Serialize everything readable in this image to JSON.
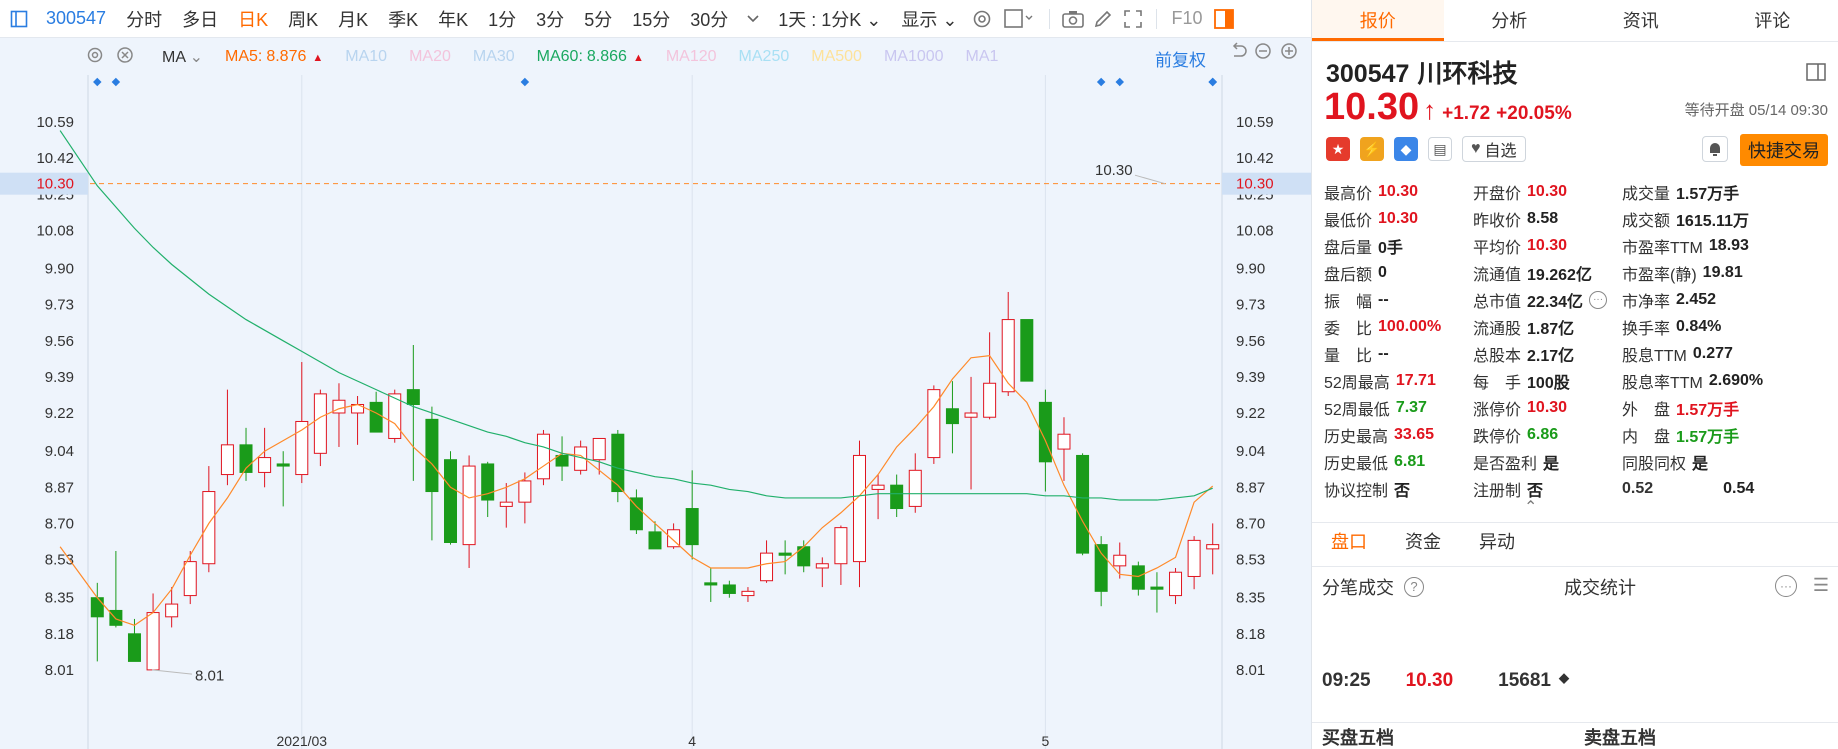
{
  "toolbar": {
    "code": "300547",
    "timeframes": [
      "分时",
      "多日",
      "日K",
      "周K",
      "月K",
      "季K",
      "年K",
      "1分",
      "3分",
      "5分",
      "15分",
      "30分"
    ],
    "active_timeframe": "日K",
    "range": "1天 : 1分K",
    "display": "显示",
    "f10": "F10"
  },
  "ma_bar": {
    "label": "MA",
    "items": [
      {
        "name": "MA5:",
        "value": "8.876",
        "color": "#ff6a00",
        "arrow": "▲"
      },
      {
        "name": "MA10",
        "value": "",
        "color": "#b8d4ef",
        "arrow": ""
      },
      {
        "name": "MA20",
        "value": "",
        "color": "#f3c4dc",
        "arrow": ""
      },
      {
        "name": "MA30",
        "value": "",
        "color": "#b8d4ef",
        "arrow": ""
      },
      {
        "name": "MA60:",
        "value": "8.866",
        "color": "#1aa860",
        "arrow": "▲"
      },
      {
        "name": "MA120",
        "value": "",
        "color": "#f3c4dc",
        "arrow": ""
      },
      {
        "name": "MA250",
        "value": "",
        "color": "#a9e0f4",
        "arrow": ""
      },
      {
        "name": "MA500",
        "value": "",
        "color": "#fde29a",
        "arrow": ""
      },
      {
        "name": "MA1000",
        "value": "",
        "color": "#c9c6f0",
        "arrow": ""
      },
      {
        "name": "MA1",
        "value": "",
        "color": "#c9c6f0",
        "arrow": ""
      }
    ],
    "fuquan": "前复权"
  },
  "chart_data": {
    "type": "candlestick",
    "y_ticks": [
      "10.59",
      "10.42",
      "10.25",
      "10.08",
      "9.90",
      "9.73",
      "9.56",
      "9.39",
      "9.22",
      "9.04",
      "8.87",
      "8.70",
      "8.53",
      "8.35",
      "8.18",
      "8.01"
    ],
    "ylim": [
      7.92,
      10.68
    ],
    "x_labels": [
      {
        "label": "2021/03",
        "index": 11
      },
      {
        "label": "4",
        "index": 32
      },
      {
        "label": "5",
        "index": 51
      }
    ],
    "current_price_label": "10.30",
    "right_annotation": "10.30",
    "low_annotation": "8.01",
    "candles": [
      {
        "o": 8.35,
        "h": 8.42,
        "l": 8.05,
        "c": 8.26
      },
      {
        "o": 8.29,
        "h": 8.57,
        "l": 8.21,
        "c": 8.22
      },
      {
        "o": 8.18,
        "h": 8.25,
        "l": 8.05,
        "c": 8.05
      },
      {
        "o": 8.01,
        "h": 8.37,
        "l": 8.01,
        "c": 8.28
      },
      {
        "o": 8.26,
        "h": 8.4,
        "l": 8.21,
        "c": 8.32
      },
      {
        "o": 8.36,
        "h": 8.57,
        "l": 8.32,
        "c": 8.52
      },
      {
        "o": 8.51,
        "h": 8.97,
        "l": 8.47,
        "c": 8.85
      },
      {
        "o": 8.93,
        "h": 9.33,
        "l": 8.88,
        "c": 9.07
      },
      {
        "o": 9.07,
        "h": 9.15,
        "l": 8.9,
        "c": 8.94
      },
      {
        "o": 8.94,
        "h": 9.15,
        "l": 8.87,
        "c": 9.01
      },
      {
        "o": 8.98,
        "h": 9.04,
        "l": 8.78,
        "c": 8.97
      },
      {
        "o": 8.93,
        "h": 9.46,
        "l": 8.89,
        "c": 9.18
      },
      {
        "o": 9.03,
        "h": 9.33,
        "l": 8.97,
        "c": 9.31
      },
      {
        "o": 9.22,
        "h": 9.36,
        "l": 9.06,
        "c": 9.28
      },
      {
        "o": 9.22,
        "h": 9.3,
        "l": 9.07,
        "c": 9.26
      },
      {
        "o": 9.27,
        "h": 9.32,
        "l": 9.15,
        "c": 9.13
      },
      {
        "o": 9.1,
        "h": 9.33,
        "l": 9.08,
        "c": 9.31
      },
      {
        "o": 9.33,
        "h": 9.54,
        "l": 8.9,
        "c": 9.26
      },
      {
        "o": 9.19,
        "h": 9.25,
        "l": 8.62,
        "c": 8.85
      },
      {
        "o": 9.0,
        "h": 9.04,
        "l": 8.6,
        "c": 8.61
      },
      {
        "o": 8.6,
        "h": 9.02,
        "l": 8.49,
        "c": 8.97
      },
      {
        "o": 8.98,
        "h": 8.99,
        "l": 8.73,
        "c": 8.81
      },
      {
        "o": 8.78,
        "h": 8.89,
        "l": 8.68,
        "c": 8.8
      },
      {
        "o": 8.8,
        "h": 8.94,
        "l": 8.7,
        "c": 8.9
      },
      {
        "o": 8.91,
        "h": 9.14,
        "l": 8.88,
        "c": 9.12
      },
      {
        "o": 9.02,
        "h": 9.11,
        "l": 8.9,
        "c": 8.97
      },
      {
        "o": 8.95,
        "h": 9.09,
        "l": 8.93,
        "c": 9.06
      },
      {
        "o": 9.0,
        "h": 9.09,
        "l": 8.93,
        "c": 9.1
      },
      {
        "o": 9.12,
        "h": 9.14,
        "l": 8.8,
        "c": 8.85
      },
      {
        "o": 8.82,
        "h": 8.86,
        "l": 8.65,
        "c": 8.67
      },
      {
        "o": 8.66,
        "h": 8.71,
        "l": 8.58,
        "c": 8.58
      },
      {
        "o": 8.59,
        "h": 8.7,
        "l": 8.58,
        "c": 8.67
      },
      {
        "o": 8.77,
        "h": 8.95,
        "l": 8.53,
        "c": 8.6
      },
      {
        "o": 8.42,
        "h": 8.49,
        "l": 8.33,
        "c": 8.41
      },
      {
        "o": 8.41,
        "h": 8.43,
        "l": 8.35,
        "c": 8.37
      },
      {
        "o": 8.36,
        "h": 8.4,
        "l": 8.33,
        "c": 8.38
      },
      {
        "o": 8.43,
        "h": 8.62,
        "l": 8.42,
        "c": 8.56
      },
      {
        "o": 8.56,
        "h": 8.62,
        "l": 8.46,
        "c": 8.55
      },
      {
        "o": 8.59,
        "h": 8.62,
        "l": 8.47,
        "c": 8.5
      },
      {
        "o": 8.49,
        "h": 8.54,
        "l": 8.4,
        "c": 8.51
      },
      {
        "o": 8.51,
        "h": 8.69,
        "l": 8.41,
        "c": 8.68
      },
      {
        "o": 8.52,
        "h": 9.09,
        "l": 8.4,
        "c": 9.02
      },
      {
        "o": 8.86,
        "h": 8.93,
        "l": 8.72,
        "c": 8.88
      },
      {
        "o": 8.88,
        "h": 8.93,
        "l": 8.73,
        "c": 8.77
      },
      {
        "o": 8.78,
        "h": 9.03,
        "l": 8.75,
        "c": 8.95
      },
      {
        "o": 9.01,
        "h": 9.35,
        "l": 8.98,
        "c": 9.33
      },
      {
        "o": 9.24,
        "h": 9.37,
        "l": 9.03,
        "c": 9.17
      },
      {
        "o": 9.2,
        "h": 9.39,
        "l": 8.86,
        "c": 9.22
      },
      {
        "o": 9.2,
        "h": 9.6,
        "l": 9.19,
        "c": 9.36
      },
      {
        "o": 9.32,
        "h": 9.79,
        "l": 9.3,
        "c": 9.66
      },
      {
        "o": 9.66,
        "h": 9.66,
        "l": 9.37,
        "c": 9.37
      },
      {
        "o": 9.27,
        "h": 9.33,
        "l": 8.85,
        "c": 8.99
      },
      {
        "o": 9.05,
        "h": 9.2,
        "l": 8.9,
        "c": 9.12
      },
      {
        "o": 9.02,
        "h": 9.03,
        "l": 8.55,
        "c": 8.56
      },
      {
        "o": 8.6,
        "h": 8.64,
        "l": 8.31,
        "c": 8.38
      },
      {
        "o": 8.5,
        "h": 8.61,
        "l": 8.44,
        "c": 8.55
      },
      {
        "o": 8.5,
        "h": 8.52,
        "l": 8.36,
        "c": 8.39
      },
      {
        "o": 8.4,
        "h": 8.47,
        "l": 8.28,
        "c": 8.39
      },
      {
        "o": 8.36,
        "h": 8.49,
        "l": 8.32,
        "c": 8.47
      },
      {
        "o": 8.45,
        "h": 8.64,
        "l": 8.39,
        "c": 8.62
      },
      {
        "o": 8.58,
        "h": 8.7,
        "l": 8.46,
        "c": 8.6
      }
    ],
    "series": [
      {
        "name": "MA5",
        "color": "#ff8a2a",
        "values": [
          8.59,
          8.47,
          8.35,
          8.25,
          8.22,
          8.28,
          8.39,
          8.55,
          8.7,
          8.82,
          8.96,
          9.04,
          9.09,
          9.14,
          9.2,
          9.24,
          9.26,
          9.22,
          9.17,
          9.06,
          8.98,
          8.87,
          8.82,
          8.84,
          8.87,
          8.91,
          8.97,
          9.03,
          9.02,
          8.95,
          8.88,
          8.78,
          8.7,
          8.62,
          8.54,
          8.49,
          8.49,
          8.49,
          8.51,
          8.52,
          8.59,
          8.68,
          8.75,
          8.83,
          8.93,
          9.06,
          9.15,
          9.25,
          9.38,
          9.48,
          9.49,
          9.36,
          9.27,
          9.09,
          8.88,
          8.71,
          8.56,
          8.46,
          8.45,
          8.49,
          8.54,
          8.8,
          8.876
        ]
      },
      {
        "name": "MA60",
        "color": "#21b06b",
        "values": [
          10.55,
          10.42,
          10.29,
          10.19,
          10.09,
          10.0,
          9.92,
          9.85,
          9.78,
          9.72,
          9.66,
          9.61,
          9.56,
          9.51,
          9.46,
          9.41,
          9.37,
          9.33,
          9.29,
          9.25,
          9.22,
          9.19,
          9.16,
          9.13,
          9.11,
          9.08,
          9.06,
          9.03,
          9.01,
          8.99,
          8.96,
          8.94,
          8.92,
          8.91,
          8.89,
          8.88,
          8.86,
          8.85,
          8.83,
          8.82,
          8.82,
          8.82,
          8.82,
          8.83,
          8.84,
          8.84,
          8.84,
          8.84,
          8.84,
          8.84,
          8.84,
          8.84,
          8.84,
          8.83,
          8.83,
          8.82,
          8.82,
          8.81,
          8.81,
          8.81,
          8.82,
          8.83,
          8.866
        ]
      }
    ]
  },
  "stock": {
    "code": "300547",
    "name": "川环科技",
    "price": "10.30",
    "arrow": "↑",
    "change": "+1.72",
    "pct": "+20.05%",
    "status": "等待开盘 05/14 09:30",
    "watch": "自选",
    "quick_trade": "快捷交易"
  },
  "quote_grid": [
    [
      {
        "l": "最高价",
        "v": "10.30",
        "c": "red"
      },
      {
        "l": "开盘价",
        "v": "10.30",
        "c": "red"
      },
      {
        "l": "成交量",
        "v": "1.57万手",
        "c": "blk"
      }
    ],
    [
      {
        "l": "最低价",
        "v": "10.30",
        "c": "red"
      },
      {
        "l": "昨收价",
        "v": "8.58",
        "c": "blk"
      },
      {
        "l": "成交额",
        "v": "1615.11万",
        "c": "blk"
      }
    ],
    [
      {
        "l": "盘后量",
        "v": "0手",
        "c": "blk"
      },
      {
        "l": "平均价",
        "v": "10.30",
        "c": "red"
      },
      {
        "l": "市盈率TTM",
        "v": "18.93",
        "c": "blk"
      }
    ],
    [
      {
        "l": "盘后额",
        "v": "0",
        "c": "blk"
      },
      {
        "l": "流通值",
        "v": "19.262亿",
        "c": "blk"
      },
      {
        "l": "市盈率(静)",
        "v": "19.81",
        "c": "blk"
      }
    ],
    [
      {
        "l": "振　幅",
        "v": "--",
        "c": "blk"
      },
      {
        "l": "总市值",
        "v": "22.34亿",
        "c": "blk"
      },
      {
        "l": "市净率",
        "v": "2.452",
        "c": "blk"
      }
    ],
    [
      {
        "l": "委　比",
        "v": "100.00%",
        "c": "red"
      },
      {
        "l": "流通股",
        "v": "1.87亿",
        "c": "blk"
      },
      {
        "l": "换手率",
        "v": "0.84%",
        "c": "blk"
      }
    ],
    [
      {
        "l": "量　比",
        "v": "--",
        "c": "blk"
      },
      {
        "l": "总股本",
        "v": "2.17亿",
        "c": "blk"
      },
      {
        "l": "股息TTM",
        "v": "0.277",
        "c": "blk"
      }
    ],
    [
      {
        "l": "52周最高",
        "v": "17.71",
        "c": "red"
      },
      {
        "l": "每　手",
        "v": "100股",
        "c": "blk"
      },
      {
        "l": "股息率TTM",
        "v": "2.690%",
        "c": "blk"
      }
    ],
    [
      {
        "l": "52周最低",
        "v": "7.37",
        "c": "green"
      },
      {
        "l": "涨停价",
        "v": "10.30",
        "c": "red"
      },
      {
        "l": "外　盘",
        "v": "1.57万手",
        "c": "red"
      }
    ],
    [
      {
        "l": "历史最高",
        "v": "33.65",
        "c": "red"
      },
      {
        "l": "跌停价",
        "v": "6.86",
        "c": "green"
      },
      {
        "l": "内　盘",
        "v": "1.57万手",
        "c": "green"
      }
    ],
    [
      {
        "l": "历史最低",
        "v": "6.81",
        "c": "green"
      },
      {
        "l": "是否盈利",
        "v": "是",
        "c": "blk"
      },
      {
        "l": "同股同权",
        "v": "是",
        "c": "blk"
      }
    ],
    [
      {
        "l": "协议控制",
        "v": "否",
        "c": "blk"
      },
      {
        "l": "注册制",
        "v": "否",
        "c": "blk"
      },
      {
        "l": "0.52",
        "v": "0.54",
        "c": "blk"
      }
    ]
  ],
  "right_tabs": [
    "报价",
    "分析",
    "资讯",
    "评论"
  ],
  "sub_tabs": [
    "盘口",
    "资金",
    "异动"
  ],
  "sub2": {
    "left": "分笔成交",
    "right": "成交统计"
  },
  "trade": {
    "time": "09:25",
    "price": "10.30",
    "vol": "15681",
    "mark": "◆"
  },
  "five": {
    "buy": "买盘五档",
    "sell": "卖盘五档"
  }
}
